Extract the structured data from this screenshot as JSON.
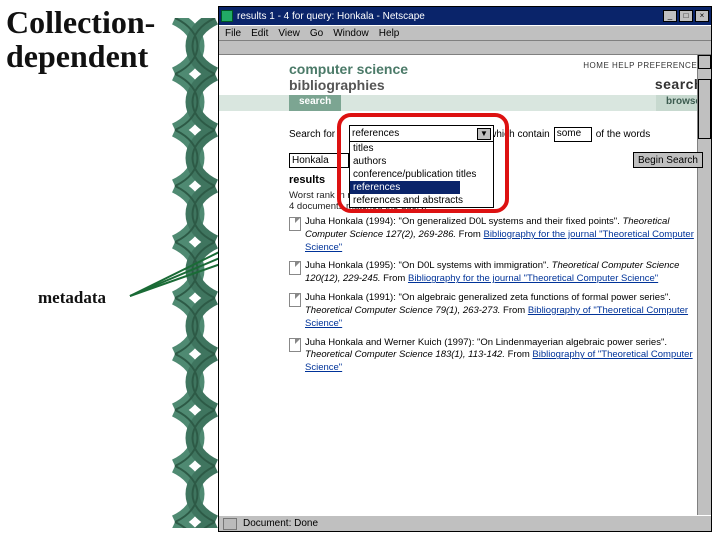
{
  "slide": {
    "title_line1": "Collection-",
    "title_line2": "dependent",
    "metadata_label": "metadata"
  },
  "window": {
    "title": "results 1 - 4 for query: Honkala - Netscape",
    "menus": [
      "File",
      "Edit",
      "View",
      "Go",
      "Window",
      "Help"
    ],
    "min_label": "_",
    "max_label": "□",
    "close_label": "×"
  },
  "site": {
    "brand_line1": "computer science",
    "brand_line2": "bibliographies",
    "top_links": "HOME  HELP  PREFERENCES",
    "search_big": "search",
    "tab_search": "search",
    "tab_browse": "browse"
  },
  "form": {
    "label_searchfor": "Search for",
    "field_select_value": "references",
    "label_whichcontain": "which contain",
    "some_value": "some",
    "label_ofwords": "of the words",
    "query_value": "Honkala",
    "begin_button": "Begin Search"
  },
  "dropdown": {
    "options": [
      "titles",
      "authors",
      "conference/publication titles",
      "references",
      "references and abstracts"
    ],
    "selected_index": 3
  },
  "results": {
    "heading": "results",
    "info_line1": "Worst rank in results: 1.07",
    "info_line2": "4 documents matched the query.",
    "items": [
      {
        "main": "Juha Honkala (1994): \"On generalized D0L systems and their fixed points\".",
        "ital": "Theoretical Computer Science 127(2), 269-286.",
        "from": " From ",
        "link": "Bibliography for the journal \"Theoretical Computer Science\""
      },
      {
        "main": "Juha Honkala (1995): \"On D0L systems with immigration\".",
        "ital": "Theoretical Computer Science 120(12), 229-245.",
        "from": " From ",
        "link": "Bibliography for the journal \"Theoretical Computer Science\""
      },
      {
        "main": "Juha Honkala (1991): \"On algebraic generalized zeta functions of formal power series\".",
        "ital": "Theoretical Computer Science 79(1), 263-273.",
        "from": " From ",
        "link": "Bibliography of \"Theoretical Computer Science\""
      },
      {
        "main": "Juha Honkala and Werner Kuich (1997): \"On Lindenmayerian algebraic power series\".",
        "ital": "Theoretical Computer Science 183(1), 113-142.",
        "from": " From ",
        "link": "Bibliography of \"Theoretical Computer Science\""
      }
    ]
  },
  "status": {
    "text": "Document: Done"
  }
}
